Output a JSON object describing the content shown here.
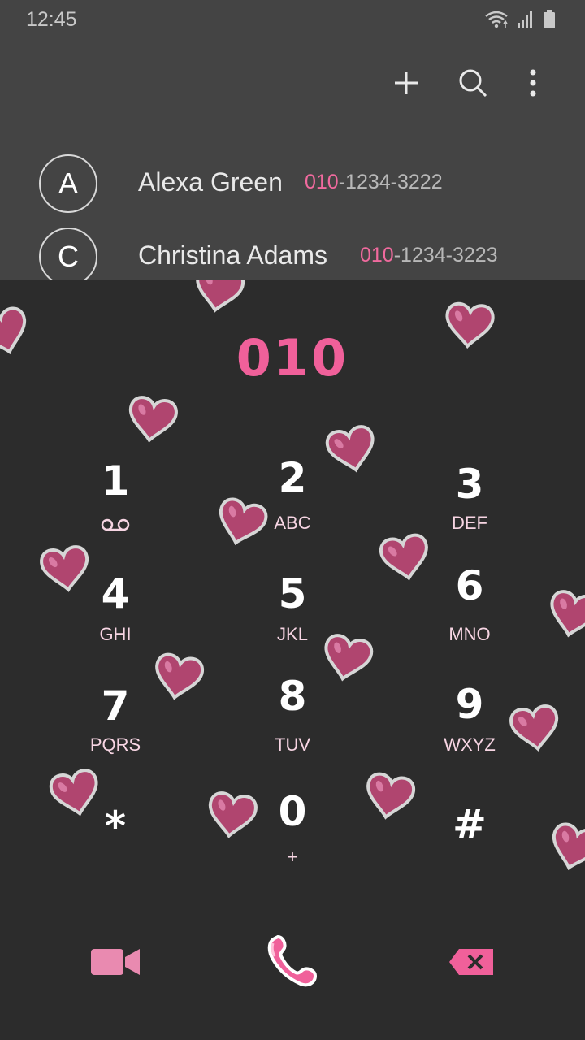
{
  "status_bar": {
    "time": "12:45",
    "icons": [
      "wifi-icon",
      "signal-icon",
      "battery-icon"
    ]
  },
  "toolbar": {
    "actions": [
      "add-icon",
      "search-icon",
      "more-options-icon"
    ]
  },
  "contacts": [
    {
      "initial": "A",
      "name": "Alexa Green",
      "number_match": "010",
      "number_rest": "-1234-3222"
    },
    {
      "initial": "C",
      "name": "Christina Adams",
      "number_match": "010",
      "number_rest": "-1234-3223"
    }
  ],
  "dialer": {
    "entered_number": "010",
    "keys": [
      {
        "digit": "1",
        "letters": "",
        "icon": "voicemail-icon"
      },
      {
        "digit": "2",
        "letters": "ABC"
      },
      {
        "digit": "3",
        "letters": "DEF"
      },
      {
        "digit": "4",
        "letters": "GHI"
      },
      {
        "digit": "5",
        "letters": "JKL"
      },
      {
        "digit": "6",
        "letters": "MNO"
      },
      {
        "digit": "7",
        "letters": "PQRS"
      },
      {
        "digit": "8",
        "letters": "TUV"
      },
      {
        "digit": "9",
        "letters": "WXYZ"
      },
      {
        "digit": "*",
        "letters": ""
      },
      {
        "digit": "0",
        "letters": "+"
      },
      {
        "digit": "#",
        "letters": ""
      }
    ]
  },
  "bottom_actions": [
    "video-call-icon",
    "call-icon",
    "backspace-icon"
  ],
  "colors": {
    "accent_pink": "#f06a9e",
    "heart_fill": "#b0456f",
    "background_top": "#444444",
    "background_dialer": "#2c2c2c"
  }
}
